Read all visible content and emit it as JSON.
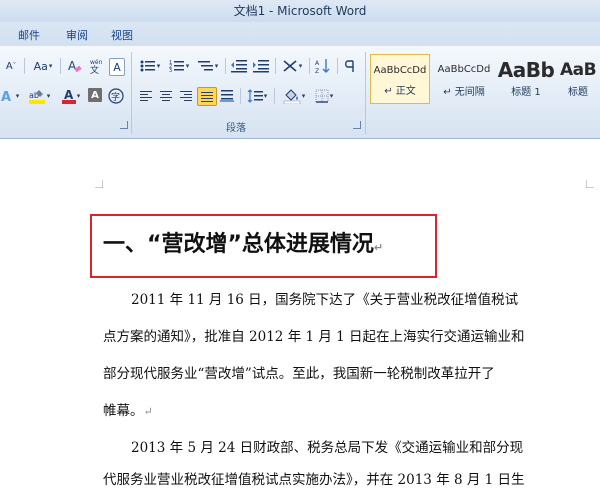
{
  "window": {
    "title": "文档1 - Microsoft Word"
  },
  "menu": {
    "tabs": [
      "邮件",
      "审阅",
      "视图"
    ]
  },
  "ribbon": {
    "font_group": {
      "aa_label": "Aa",
      "clear_format": "A",
      "char_border": "A",
      "phonetic": "文"
    },
    "paragraph_group": {
      "label": "段落"
    },
    "styles": [
      {
        "sample": "AaBbCcDd",
        "name": "正文"
      },
      {
        "sample": "AaBbCcDd",
        "name": "无间隔"
      },
      {
        "sample": "AaBb",
        "name": "标题 1"
      },
      {
        "sample": "AaB",
        "name": "标题"
      }
    ]
  },
  "colors": {
    "highlight": "#ffe600",
    "font_color": "#d8262b",
    "annotation_box": "#d8262b"
  },
  "document": {
    "heading": "一、“营改增”总体进展情况",
    "paragraphs": [
      {
        "lines": [
          "2011 年 11 月 16 日，国务院下达了《关于营业税改征增值税试",
          "点方案的通知》，批准自 2012 年 1 月 1 日起在上海实行交通运输业和",
          "部分现代服务业“营改增”试点。至此，我国新一轮税制改革拉开了",
          "帷幕。"
        ]
      },
      {
        "lines": [
          "2013 年 5 月 24 日财政部、税务总局下发《交通运输业和部分现",
          "代服务业营业税改征增值税试点实施办法》，并在 2013 年 8 月 1 日生"
        ]
      }
    ],
    "paragraph_mark": "↵"
  }
}
